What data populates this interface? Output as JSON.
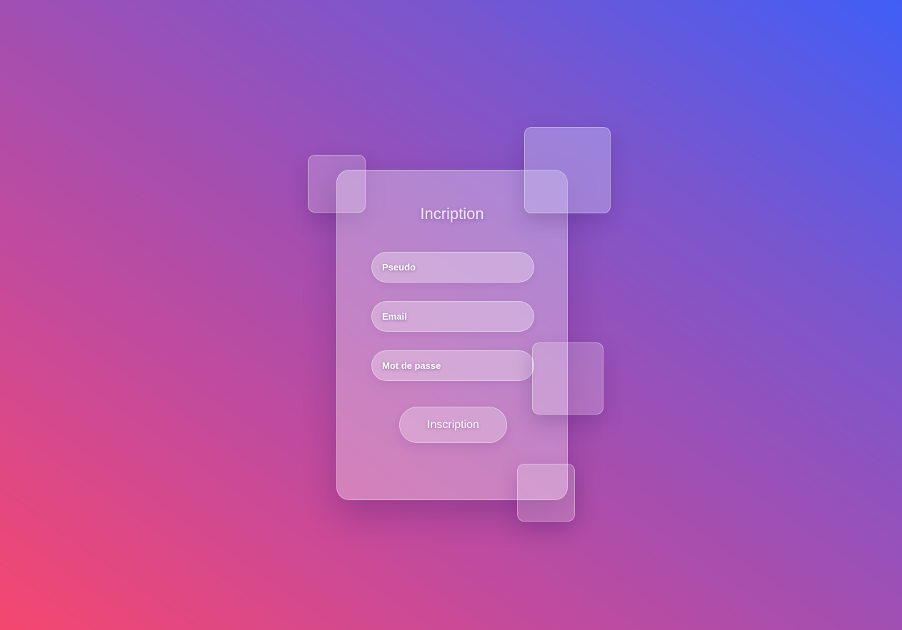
{
  "form": {
    "title": "Incription",
    "fields": [
      {
        "name": "pseudo",
        "placeholder": "Pseudo",
        "value": ""
      },
      {
        "name": "email",
        "placeholder": "Email",
        "value": ""
      },
      {
        "name": "password",
        "placeholder": "Mot de passe",
        "value": ""
      }
    ],
    "submit_label": "Inscription"
  },
  "colors": {
    "gradient_start": "#f5476f",
    "gradient_mid": "#a14fb2",
    "gradient_end": "#405ef6",
    "text": "#ffffff"
  }
}
